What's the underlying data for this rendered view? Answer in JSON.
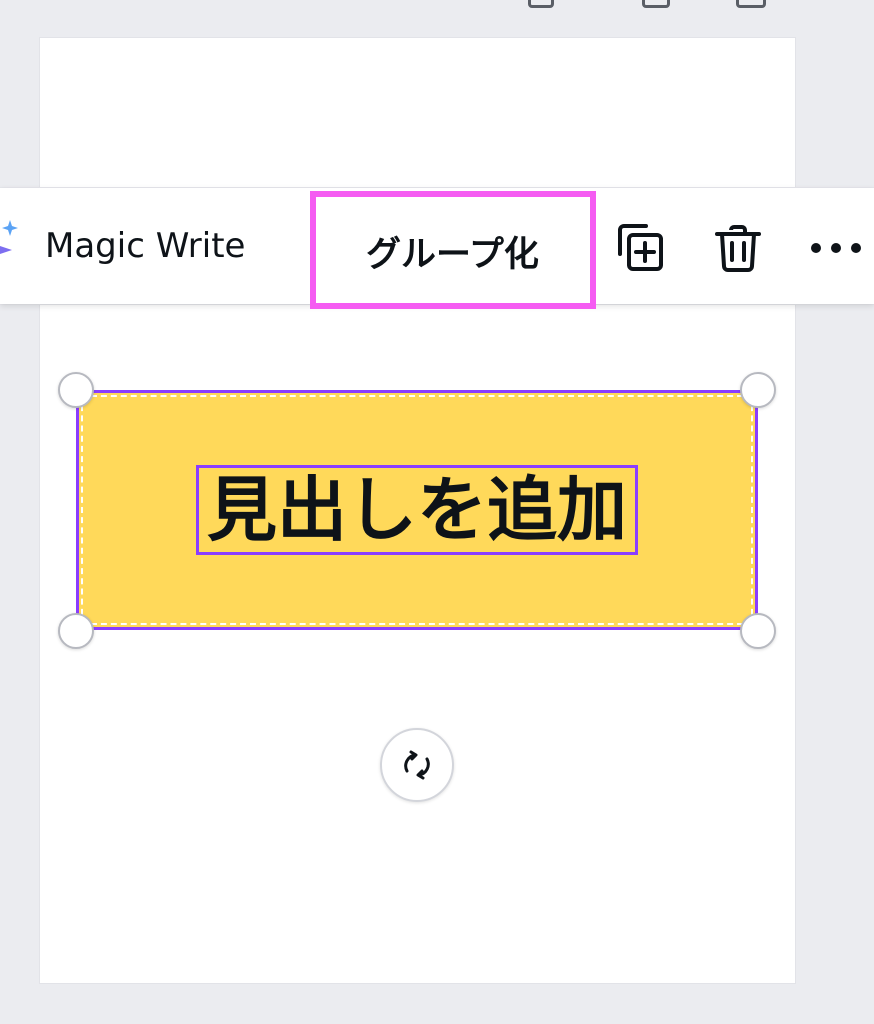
{
  "toolbar": {
    "magic_write_label": "Magic Write",
    "group_label": "グループ化",
    "duplicate_icon": "duplicate-icon",
    "delete_icon": "trash-icon",
    "more_icon": "more-options-icon"
  },
  "canvas": {
    "heading_text": "見出しを追加",
    "element_fill": "#ffd95a",
    "selection_color": "#8b3dff",
    "highlight_color": "#f55cf2"
  }
}
